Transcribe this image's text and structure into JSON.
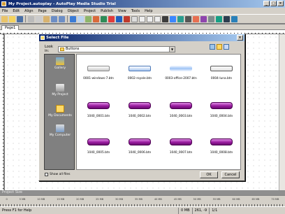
{
  "window": {
    "title": "My Project.autoplay - AutoPlay Media Studio Trial"
  },
  "menu": [
    "File",
    "Edit",
    "Align",
    "Page",
    "Dialog",
    "Object",
    "Project",
    "Publish",
    "View",
    "Tools",
    "Help"
  ],
  "tabs": [
    "Page1"
  ],
  "dialog": {
    "title": "Select File",
    "look_in_label": "Look in:",
    "look_in_value": "Buttons",
    "places": [
      "Gallery",
      "My Project",
      "My Documents",
      "My Computer"
    ],
    "files": [
      {
        "name": "0001-windows-7.btn",
        "style": "gray"
      },
      {
        "name": "0002-royale.btn",
        "style": "blue"
      },
      {
        "name": "0003-office-2007.btn",
        "style": "glow"
      },
      {
        "name": "0004-luna.btn",
        "style": "silver"
      },
      {
        "name": "1040_0001.btn",
        "style": "purple"
      },
      {
        "name": "1040_0002.btn",
        "style": "purple"
      },
      {
        "name": "1040_0003.btn",
        "style": "purple"
      },
      {
        "name": "1040_0004.btn",
        "style": "purple"
      },
      {
        "name": "1040_0005.btn",
        "style": "purple"
      },
      {
        "name": "1040_0006.btn",
        "style": "purple"
      },
      {
        "name": "1040_0007.btn",
        "style": "purple"
      },
      {
        "name": "1040_0008.btn",
        "style": "purple"
      }
    ],
    "show_all_files": "Show all files",
    "ok": "OK",
    "cancel": "Cancel"
  },
  "panel": {
    "label": "Project Size"
  },
  "ruler_numbers": [
    "0",
    "5 MB",
    "10 MB",
    "15 MB",
    "20 MB",
    "25 MB",
    "30 MB",
    "35 MB",
    "40 MB",
    "45 MB",
    "50 MB",
    "55 MB",
    "60 MB",
    "65 MB",
    "70 MB"
  ],
  "status": {
    "help": "Press F1 for Help",
    "size": "0 MB",
    "coords": "261, -9",
    "zoom": "1/1"
  }
}
